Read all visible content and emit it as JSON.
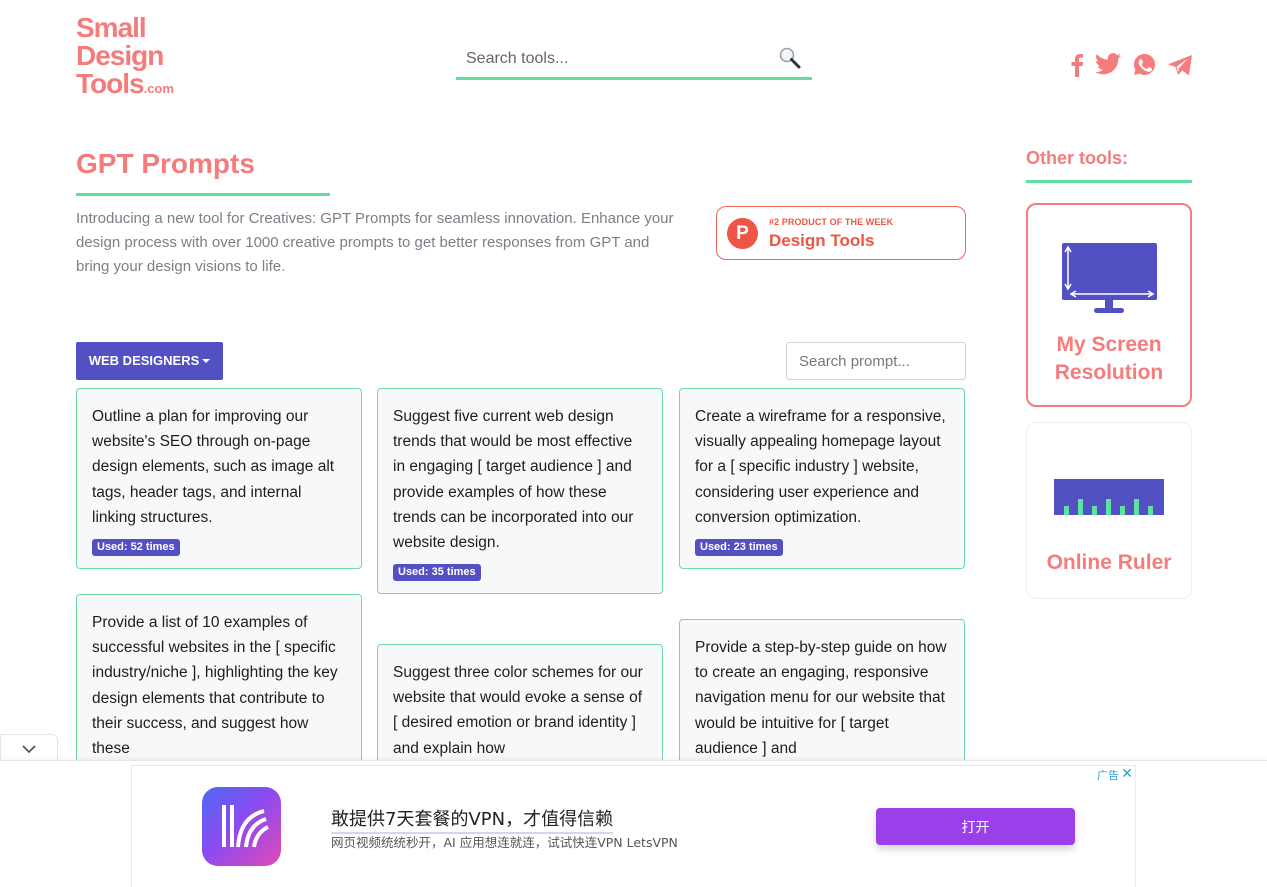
{
  "header": {
    "logo": {
      "line1": "Small",
      "line2": "Design",
      "line3": "Tools",
      "suffix": ".com"
    },
    "search": {
      "placeholder": "Search tools...",
      "icon": "search-icon"
    },
    "social": [
      {
        "name": "facebook",
        "icon": "facebook-icon"
      },
      {
        "name": "twitter",
        "icon": "twitter-icon"
      },
      {
        "name": "whatsapp",
        "icon": "whatsapp-icon"
      },
      {
        "name": "telegram",
        "icon": "telegram-icon"
      }
    ]
  },
  "main": {
    "title": "GPT Prompts",
    "intro": "Introducing a new tool for Creatives: GPT Prompts for seamless innovation. Enhance your design process with over 1000 creative prompts to get better responses from GPT and bring your design visions to life.",
    "product_hunt": {
      "logo_letter": "P",
      "rank": "#2 PRODUCT OF THE WEEK",
      "category": "Design Tools"
    },
    "category_dropdown": {
      "selected": "WEB DESIGNERS"
    },
    "prompt_search": {
      "placeholder": "Search prompt..."
    },
    "prompts": [
      {
        "text": "Outline a plan for improving our website's SEO through on-page design elements, such as image alt tags, header tags, and internal linking structures.",
        "used": "Used: 52 times"
      },
      {
        "text": "Suggest five current web design trends that would be most effective in engaging [ target audience ] and provide examples of how these trends can be incorporated into our website design.",
        "used": "Used: 35 times"
      },
      {
        "text": "Create a wireframe for a responsive, visually appealing homepage layout for a [ specific industry ] website, considering user experience and conversion optimization.",
        "used": "Used: 23 times"
      },
      {
        "text": "Provide a list of 10 examples of successful websites in the [ specific industry/niche ], highlighting the key design elements that contribute to their success, and suggest how these",
        "used": ""
      },
      {
        "text": "Suggest three color schemes for our website that would evoke a sense of [ desired emotion or brand identity ] and explain how",
        "used": ""
      },
      {
        "text": "Provide a step-by-step guide on how to create an engaging, responsive navigation menu for our website that would be intuitive for [ target audience ] and",
        "used": ""
      }
    ]
  },
  "sidebar": {
    "title": "Other tools:",
    "tools": [
      {
        "name": "My Screen Resolution",
        "line1": "My Screen",
        "line2": "Resolution",
        "icon": "monitor-icon"
      },
      {
        "name": "Online Ruler",
        "icon": "ruler-icon"
      }
    ]
  },
  "ad": {
    "label": "广告",
    "close": "✕",
    "title": "敢提供7天套餐的VPN，才值得信赖",
    "subtitle": "网页视频统统秒开，AI 应用想连就连，试试快连VPN LetsVPN",
    "button": "打开"
  },
  "colors": {
    "brand": "#f47c7c",
    "accent_green": "#5fe0a0",
    "primary_purple": "#5350c4",
    "ad_button": "#9b3fe8"
  }
}
